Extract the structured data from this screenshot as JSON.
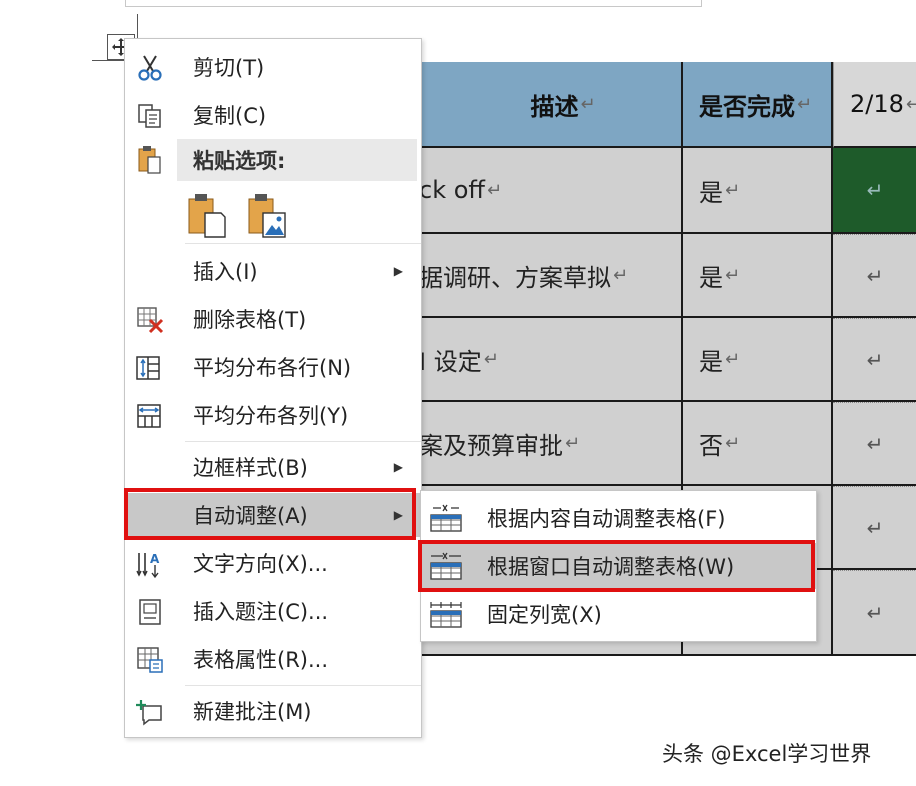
{
  "table": {
    "header": {
      "col1": "描述",
      "col2": "是否完成",
      "col3": "2/18"
    },
    "rows": [
      {
        "col1": "ck off",
        "col2": "是"
      },
      {
        "col1": "据调研、方案草拟",
        "col2": "是"
      },
      {
        "col1": "I 设定",
        "col2": "是"
      },
      {
        "col1": "案及预算审批",
        "col2": "否"
      },
      {
        "col1": "",
        "col2": ""
      },
      {
        "col1": "",
        "col2": ""
      }
    ],
    "return_mark": "↵"
  },
  "context_menu": {
    "cut": "剪切(T)",
    "copy": "复制(C)",
    "paste_options": "粘贴选项:",
    "insert": "插入(I)",
    "delete_table": "删除表格(T)",
    "distribute_rows": "平均分布各行(N)",
    "distribute_columns": "平均分布各列(Y)",
    "border_styles": "边框样式(B)",
    "autofit": "自动调整(A)",
    "text_direction": "文字方向(X)...",
    "insert_caption": "插入题注(C)...",
    "table_properties": "表格属性(R)...",
    "new_comment": "新建批注(M)"
  },
  "autofit_submenu": {
    "autofit_contents": "根据内容自动调整表格(F)",
    "autofit_window": "根据窗口自动调整表格(W)",
    "fixed_column_width": "固定列宽(X)"
  },
  "watermark": "头条 @Excel学习世界",
  "colors": {
    "header_blue": "#7ea6c3",
    "cell_gray": "#d0d0d0",
    "highlight_red": "#e01010",
    "dark_green": "#1e5b2a"
  }
}
